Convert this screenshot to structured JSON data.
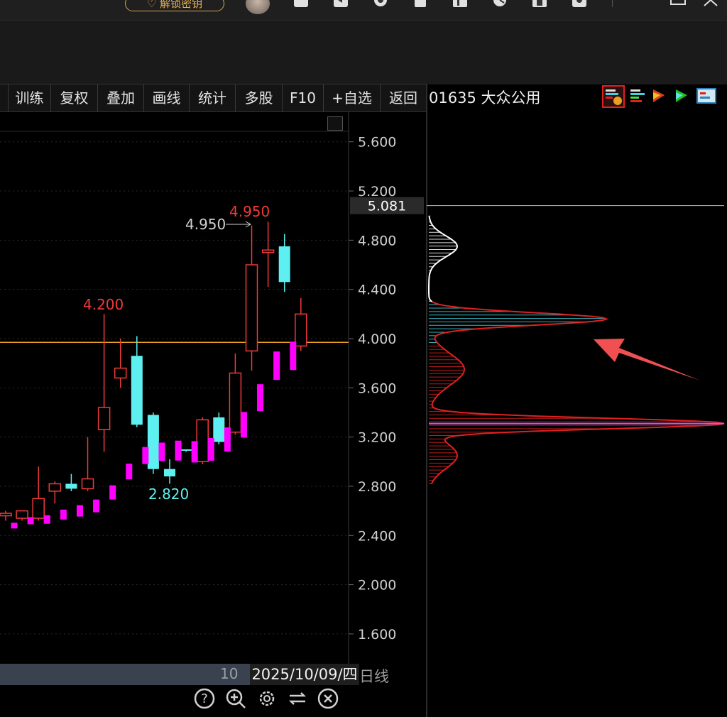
{
  "topbar": {
    "unlock_label": "解锁密钥",
    "icons": [
      "avatar",
      "cube-icon",
      "rewind-icon",
      "clock-icon",
      "clipboard-icon",
      "chart-bar-icon",
      "timer-icon",
      "phone-icon",
      "gear-icon"
    ]
  },
  "menu": {
    "items": [
      "训练",
      "复权",
      "叠加",
      "画线",
      "统计",
      "多股",
      "F10",
      "+自选",
      "返回"
    ]
  },
  "right_panel": {
    "title": "01635 大众公用",
    "tool_icons": [
      "chip-distribution-icon",
      "bar-list-icon",
      "flag-red-icon",
      "flag-green-icon",
      "info-panel-icon"
    ]
  },
  "price_axis": {
    "labels": [
      "5.600",
      "5.200",
      "4.800",
      "4.400",
      "4.000",
      "3.600",
      "3.200",
      "2.800",
      "2.400",
      "2.000",
      "1.600"
    ],
    "current_price_label": "5.081"
  },
  "annotations": {
    "high_white": "4.950",
    "high_red": "4.950",
    "peak_4200": "4.200",
    "low_2820": "2.820"
  },
  "bottom": {
    "number": "10",
    "date": "2025/10/09/四",
    "period": "日线"
  },
  "controls": [
    "help-icon",
    "zoom-in-icon",
    "settings-icon",
    "refresh-icon",
    "close-icon"
  ],
  "colors": {
    "up": "#f03a3a",
    "down": "#5ef0f0",
    "volume": "#ff00ff",
    "ma_line": "#e8a020",
    "profile_upper": "#ffffff",
    "profile_cyan": "#3fd4e0",
    "profile_red": "#e02020",
    "cost_line": "#b060ff"
  },
  "chart_data": {
    "type": "candlestick",
    "y_axis": {
      "min": 1.4,
      "max": 5.8,
      "ticks": [
        5.6,
        5.2,
        4.8,
        4.4,
        4.0,
        3.6,
        3.2,
        2.8,
        2.4,
        2.0,
        1.6
      ]
    },
    "reference_line": 3.97,
    "current_price": 5.081,
    "candles": [
      {
        "o": 2.56,
        "h": 2.6,
        "l": 2.52,
        "c": 2.58
      },
      {
        "o": 2.54,
        "h": 2.6,
        "l": 2.52,
        "c": 2.6
      },
      {
        "o": 2.54,
        "h": 2.96,
        "l": 2.52,
        "c": 2.7
      },
      {
        "o": 2.76,
        "h": 2.84,
        "l": 2.66,
        "c": 2.82
      },
      {
        "o": 2.82,
        "h": 2.9,
        "l": 2.76,
        "c": 2.78
      },
      {
        "o": 2.78,
        "h": 3.2,
        "l": 2.76,
        "c": 2.86
      },
      {
        "o": 3.26,
        "h": 4.2,
        "l": 3.08,
        "c": 3.44
      },
      {
        "o": 3.68,
        "h": 4.0,
        "l": 3.6,
        "c": 3.76
      },
      {
        "o": 3.86,
        "h": 4.02,
        "l": 3.28,
        "c": 3.3
      },
      {
        "o": 3.38,
        "h": 3.4,
        "l": 2.9,
        "c": 2.94
      },
      {
        "o": 2.94,
        "h": 3.02,
        "l": 2.82,
        "c": 2.88
      },
      {
        "o": 3.1,
        "h": 3.1,
        "l": 3.08,
        "c": 3.09
      },
      {
        "o": 3.0,
        "h": 3.36,
        "l": 2.98,
        "c": 3.34
      },
      {
        "o": 3.36,
        "h": 3.4,
        "l": 3.14,
        "c": 3.16
      },
      {
        "o": 3.24,
        "h": 3.88,
        "l": 3.22,
        "c": 3.72
      },
      {
        "o": 3.9,
        "h": 4.92,
        "l": 3.74,
        "c": 4.6
      },
      {
        "o": 4.7,
        "h": 4.95,
        "l": 4.42,
        "c": 4.72
      },
      {
        "o": 4.75,
        "h": 4.85,
        "l": 4.38,
        "c": 4.46
      },
      {
        "o": 3.94,
        "h": 4.33,
        "l": 3.9,
        "c": 4.2
      }
    ],
    "volume_marks": [
      2.48,
      2.52,
      2.53,
      2.57,
      2.6,
      2.64,
      2.75,
      2.92,
      3.05,
      3.08,
      3.09,
      3.08,
      3.1,
      3.18,
      3.3,
      3.52,
      3.78,
      3.86
    ],
    "profile_peaks": [
      {
        "price": 4.16,
        "extent": 0.6,
        "color": "cyan"
      },
      {
        "price": 3.31,
        "extent": 1.0,
        "color": "red"
      }
    ]
  }
}
